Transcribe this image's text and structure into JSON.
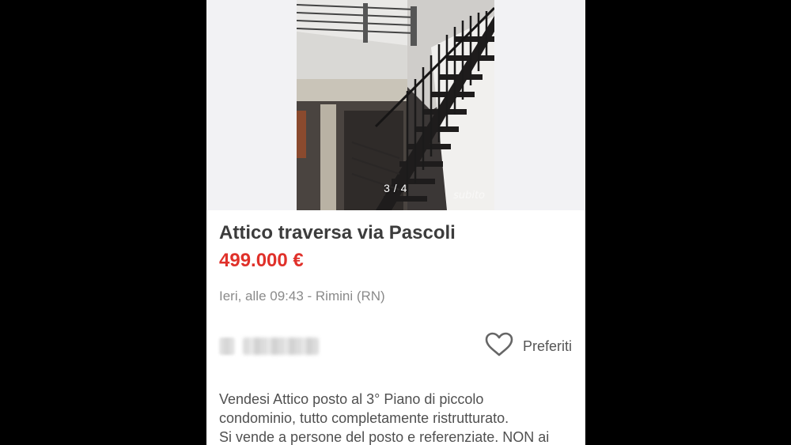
{
  "gallery": {
    "counter": "3 / 4",
    "watermark": "subito"
  },
  "listing": {
    "title": "Attico traversa via Pascoli",
    "price": "499.000 €",
    "meta": "Ieri, alle 09:43 - Rimini (RN)"
  },
  "favorites": {
    "label": "Preferiti",
    "icon": "heart-outline-icon"
  },
  "description": {
    "line1": "Vendesi Attico posto al 3° Piano di piccolo",
    "line2": "condominio, tutto completamente ristrutturato.",
    "line3": "Si vende a persone del posto e referenziate. NON ai"
  },
  "colors": {
    "price": "#e0312a",
    "title": "#3c3c3c",
    "meta": "#8a8a8a",
    "background": "#000000"
  }
}
